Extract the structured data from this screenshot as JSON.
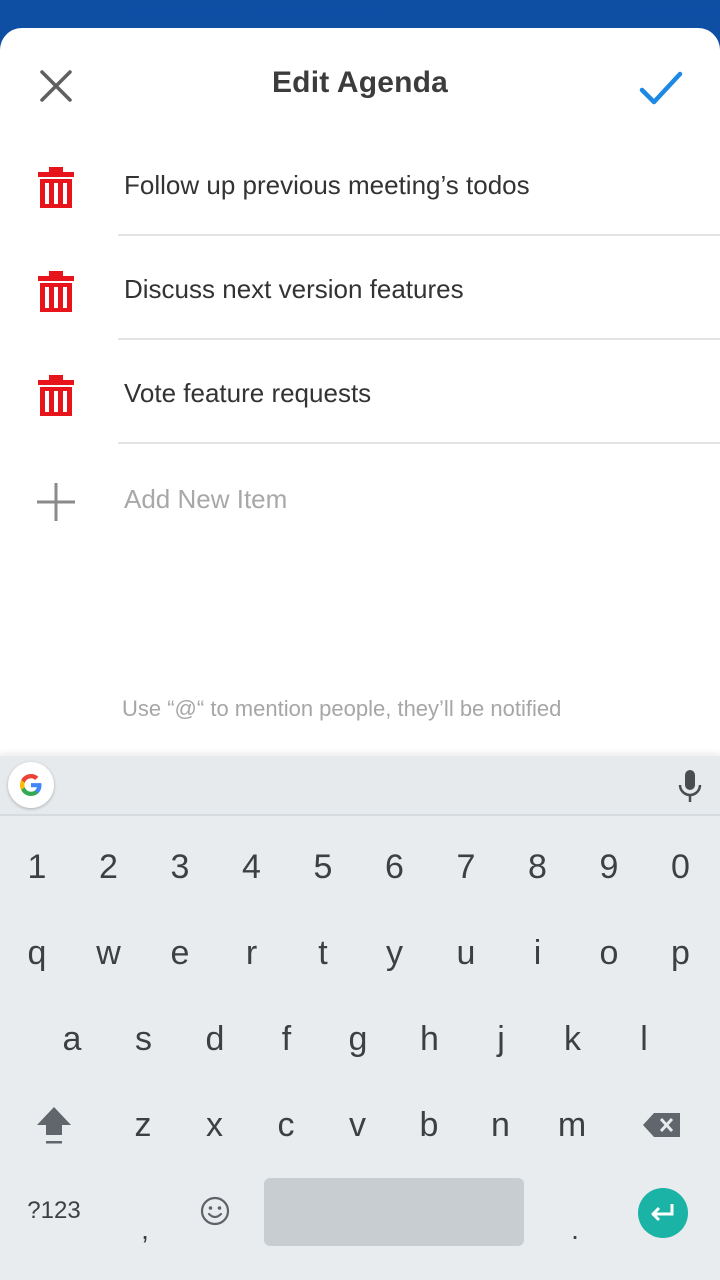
{
  "header": {
    "title": "Edit Agenda"
  },
  "agenda": {
    "items": [
      {
        "label": "Follow up previous meeting’s todos"
      },
      {
        "label": "Discuss next version features"
      },
      {
        "label": "Vote feature requests"
      }
    ],
    "add_placeholder": "Add New Item",
    "hint": "Use “@“ to mention people, they’ll be notified"
  },
  "keyboard": {
    "numbers": [
      "1",
      "2",
      "3",
      "4",
      "5",
      "6",
      "7",
      "8",
      "9",
      "0"
    ],
    "row1": [
      "q",
      "w",
      "e",
      "r",
      "t",
      "y",
      "u",
      "i",
      "o",
      "p"
    ],
    "row2": [
      "a",
      "s",
      "d",
      "f",
      "g",
      "h",
      "j",
      "k",
      "l"
    ],
    "row3": [
      "z",
      "x",
      "c",
      "v",
      "b",
      "n",
      "m"
    ],
    "symbols_label": "?123",
    "comma": ",",
    "period": "."
  },
  "colors": {
    "accent_blue": "#1e88e5",
    "delete_red": "#e8141c",
    "enter_teal": "#1ab3a6"
  },
  "icons": [
    "close-icon",
    "checkmark-icon",
    "trash-icon",
    "plus-icon",
    "google-logo-icon",
    "mic-icon",
    "shift-icon",
    "backspace-icon",
    "emoji-icon",
    "enter-icon"
  ]
}
